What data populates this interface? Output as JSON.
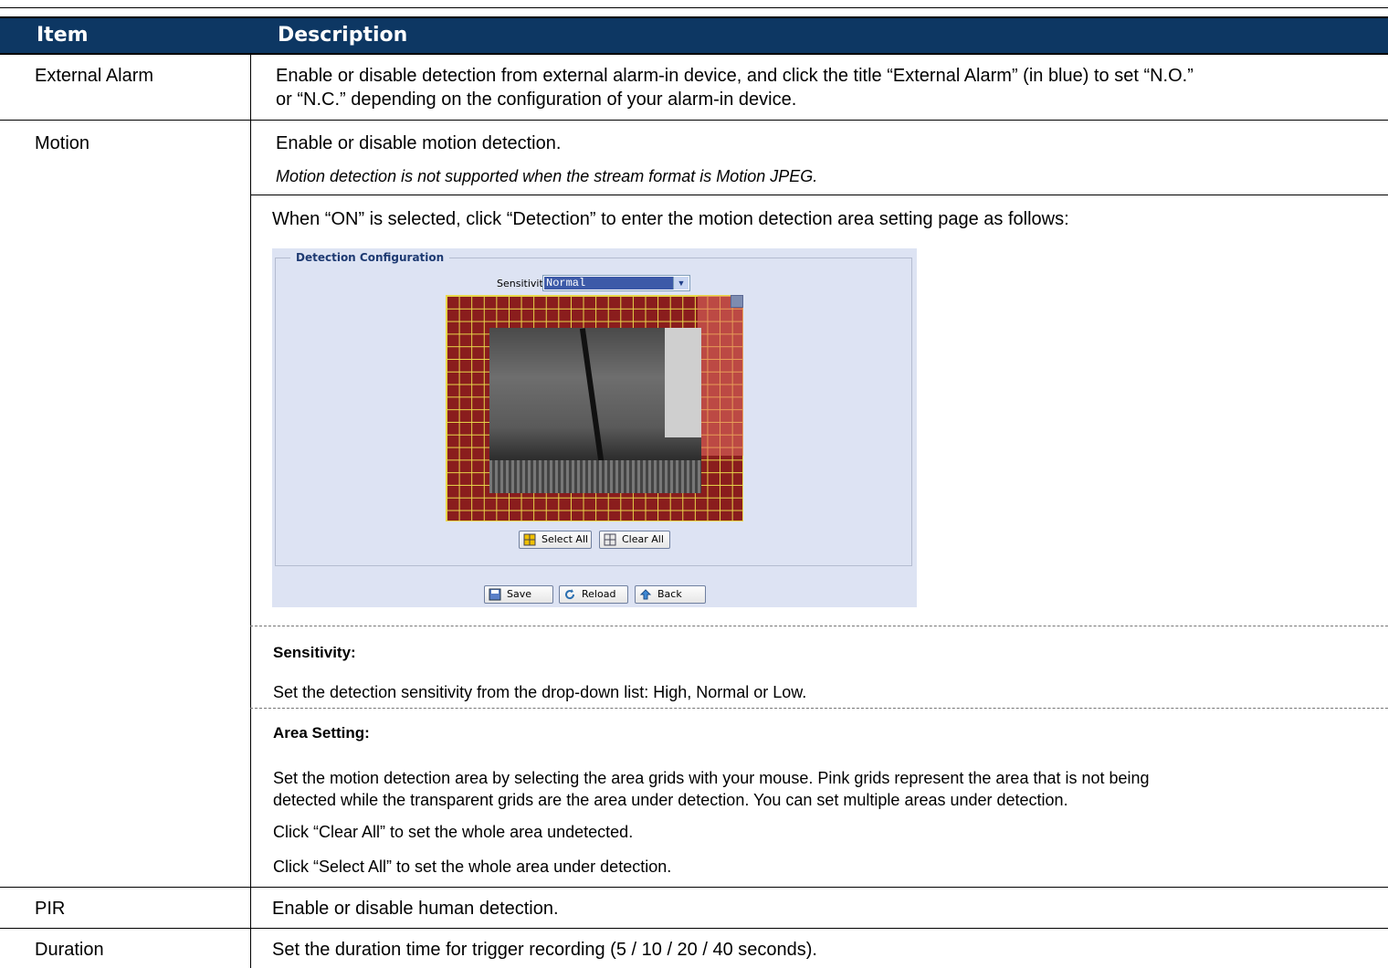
{
  "header": {
    "col_item": "Item",
    "col_description": "Description"
  },
  "rows": {
    "external_alarm": {
      "item": "External Alarm",
      "desc_line1": "Enable or disable detection from external alarm-in device, and click the title “External Alarm” (in blue) to set    “N.O.”",
      "desc_line2": "or “N.C.” depending on the configuration of your alarm-in device."
    },
    "motion": {
      "item": "Motion",
      "desc": "Enable or disable motion detection.",
      "note": "Motion detection is not supported when the stream format is Motion JPEG.",
      "intro": "When “ON” is selected, click “Detection” to enter the motion detection area setting page as follows:",
      "sensitivity_title": "Sensitivity:",
      "sensitivity_text": "Set the detection sensitivity from the drop-down list: High, Normal or Low.",
      "area_title": "Area Setting:",
      "area_line1": "Set the motion detection area by selecting the area grids with your mouse. Pink grids represent the area that is not being",
      "area_line2": "detected while the transparent grids are the area under detection. You can set multiple areas under detection.",
      "area_line3": "Click “Clear All” to set the whole area undetected.",
      "area_line4": "Click “Select All” to set the whole area under detection."
    },
    "pir": {
      "item": "PIR",
      "desc": "Enable or disable human detection."
    },
    "duration": {
      "item": "Duration",
      "desc": "Set the duration time for trigger recording (5 / 10 / 20 / 40 seconds)."
    }
  },
  "screenshot": {
    "legend": "Detection Configuration",
    "sensitivity_label": "Sensitivity:",
    "sensitivity_value": "Normal",
    "select_all": "Select All",
    "clear_all": "Clear All",
    "save": "Save",
    "reload": "Reload",
    "back": "Back"
  },
  "colors": {
    "header_bg": "#0d3763",
    "grid_fill": "#8a1d1d",
    "grid_line": "#e8d84a",
    "panel_bg": "#dde3f3"
  }
}
